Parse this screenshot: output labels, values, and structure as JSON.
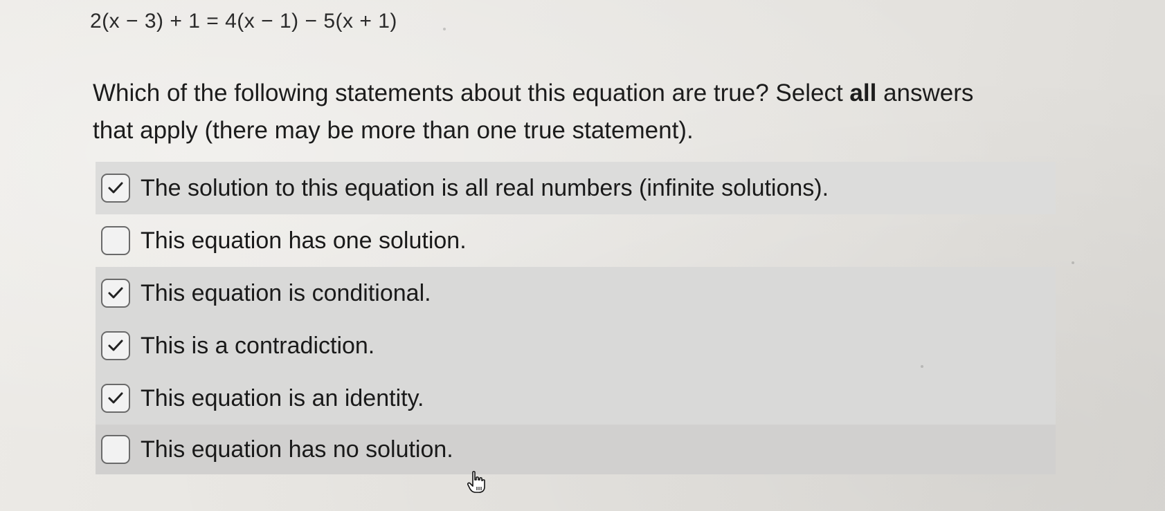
{
  "equation": "2(x − 3) + 1  =  4(x − 1) − 5(x + 1)",
  "question": {
    "line1_pre": "Which of the following statements about this equation are true?  Select ",
    "line1_bold": "all",
    "line1_post": " answers",
    "line2": "that apply (there may be more than one true statement)."
  },
  "options": [
    {
      "label": "The solution to this equation is all real numbers (infinite solutions).",
      "checked": true
    },
    {
      "label": "This equation has one solution.",
      "checked": false
    },
    {
      "label": "This equation is conditional.",
      "checked": true
    },
    {
      "label": "This is a contradiction.",
      "checked": true
    },
    {
      "label": "This equation is an identity.",
      "checked": true
    },
    {
      "label": "This equation has no solution.",
      "checked": false
    }
  ],
  "icons": {
    "checked": "checkmark-icon",
    "cursor": "hand-pointer-icon"
  },
  "colors": {
    "shaded_row": "#d9d9d8",
    "checkbox_border": "#6a6a6a",
    "check_mark": "#222222"
  }
}
